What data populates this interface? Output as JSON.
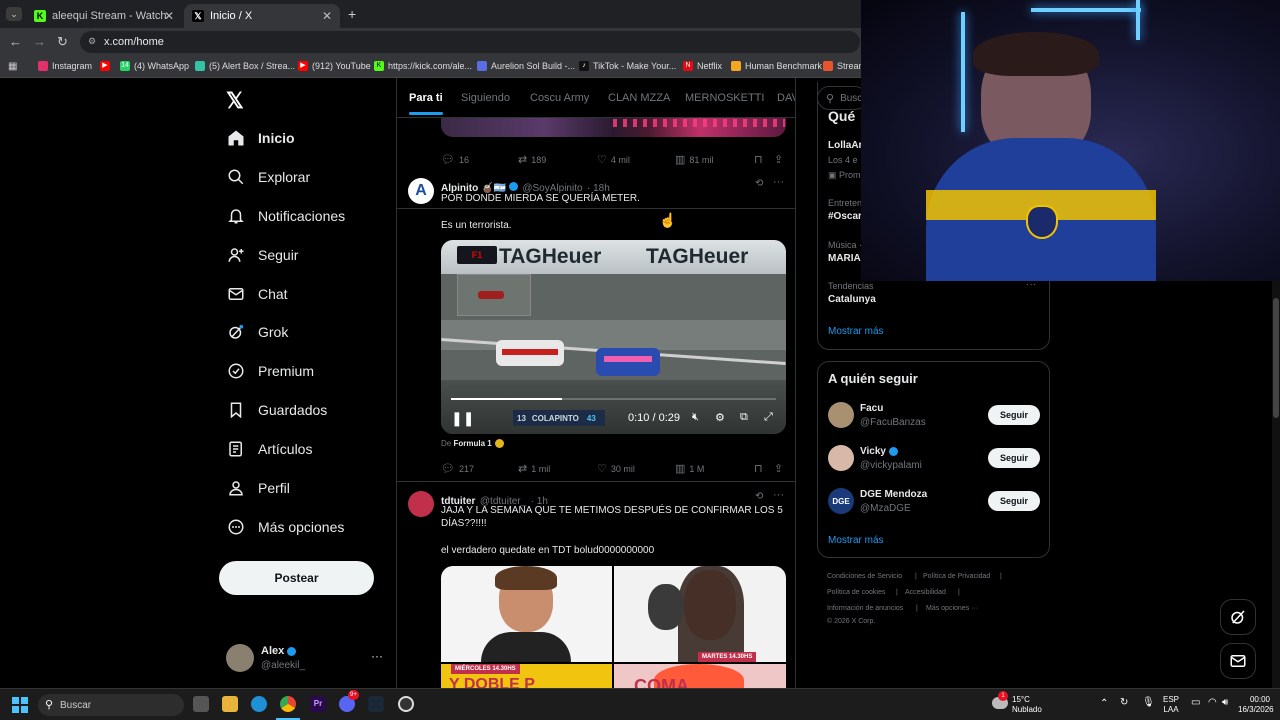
{
  "browser": {
    "tabs": [
      {
        "title": "aleequi Stream - Watch Live on",
        "favicon_color": "#53fc18",
        "favicon_text": "K"
      },
      {
        "title": "Inicio / X",
        "favicon_color": "#000000",
        "favicon_text": "𝕏"
      }
    ],
    "url": "x.com/home",
    "bookmarks": [
      {
        "label": "Instagram",
        "color": "#e1306c"
      },
      {
        "label": "(4) WhatsApp",
        "color": "#25d366",
        "badge": "14"
      },
      {
        "label": "(5) Alert Box / Strea...",
        "color": "#31c3a2"
      },
      {
        "label": "(912) YouTube",
        "color": "#ff0000"
      },
      {
        "label": "https://kick.com/ale...",
        "color": "#53fc18"
      },
      {
        "label": "Aurelion Sol Build -...",
        "color": "#5b6ee1"
      },
      {
        "label": "TikTok - Make Your...",
        "color": "#111111"
      },
      {
        "label": "Netflix",
        "color": "#e50914"
      },
      {
        "label": "Human Benchmark",
        "color": "#f5a623"
      },
      {
        "label": "Stream",
        "color": "#e8552d"
      }
    ]
  },
  "nav": {
    "logo": "𝕏",
    "items": [
      {
        "label": "Inicio",
        "icon": "home-icon"
      },
      {
        "label": "Explorar",
        "icon": "search-icon"
      },
      {
        "label": "Notificaciones",
        "icon": "bell-icon"
      },
      {
        "label": "Seguir",
        "icon": "add-user-icon"
      },
      {
        "label": "Chat",
        "icon": "mail-icon"
      },
      {
        "label": "Grok",
        "icon": "grok-icon"
      },
      {
        "label": "Premium",
        "icon": "verified-badge-icon"
      },
      {
        "label": "Guardados",
        "icon": "bookmark-icon"
      },
      {
        "label": "Artículos",
        "icon": "article-icon"
      },
      {
        "label": "Perfil",
        "icon": "user-icon"
      },
      {
        "label": "Más opciones",
        "icon": "more-circle-icon"
      }
    ],
    "post_label": "Postear",
    "account": {
      "name": "Alex",
      "handle": "@aleekil_"
    }
  },
  "timeline": {
    "tabs": [
      "Para ti",
      "Siguiendo",
      "Coscu Army",
      "CLAN MZZA",
      "MERNOSKETTI",
      "DAV"
    ],
    "top_tweet_actions": {
      "replies": "16",
      "reposts": "189",
      "likes": "4 mil",
      "views": "81 mil"
    },
    "tweets": [
      {
        "name": "Alpinito 🧉🇦🇷",
        "handle": "@SoyAlpinito",
        "time": "· 18h",
        "avatar_letter": "A",
        "lines": [
          "POR DONDE MIERDA SE QUERÍA METER.",
          "Es un terrorista."
        ],
        "video": {
          "time": "0:10 / 0:29",
          "banner": "TAGHeuer",
          "car_number": "13",
          "driver": "COLAPINTO",
          "gap": "43"
        },
        "source_prefix": "De",
        "source_name": "Formula 1",
        "actions": {
          "replies": "217",
          "reposts": "1 mil",
          "likes": "30 mil",
          "views": "1 M"
        }
      },
      {
        "name": "tdtuiter",
        "handle": "@tdtuiter_",
        "time": "· 1h",
        "lines": [
          "JAJA Y LA SEMANA QUE TE METIMOS DESPUÉS DE CONFIRMAR LOS 5",
          "DÍAS??!!!!",
          "el verdadero quedate en TDT bolud0000000000"
        ],
        "image_captions": [
          "MIÉRCOLES 14.30HS",
          "MARTES 14.30HS",
          "Y DOBLE P",
          "COMA"
        ]
      }
    ]
  },
  "right": {
    "search_placeholder": "Busc",
    "trends_heading_partial": "Qué",
    "trends": [
      {
        "category": "",
        "title": "LollaAr",
        "sub": "Los 4 e",
        "promo": "Prom"
      },
      {
        "category": "Entreten",
        "title": "#Oscar"
      },
      {
        "category": "Música ·",
        "title": "MARIA"
      },
      {
        "category": "Tendencias",
        "title": "Catalunya"
      }
    ],
    "show_more": "Mostrar más",
    "who_to_follow": {
      "title": "A quién seguir",
      "users": [
        {
          "name": "Facu",
          "handle": "@FacuBanzas",
          "verified": false
        },
        {
          "name": "Vicky",
          "handle": "@vickypalami",
          "verified": true
        },
        {
          "name": "DGE Mendoza",
          "handle": "@MzaDGE",
          "verified": false,
          "logo": "DGE"
        }
      ],
      "follow_label": "Seguir",
      "show_more": "Mostrar más"
    },
    "footer": {
      "links": [
        "Condiciones de Servicio",
        "Política de Privacidad",
        "Política de cookies",
        "Accesibilidad",
        "Información de anuncios",
        "Más opciones ···"
      ],
      "copyright": "© 2026 X Corp."
    }
  },
  "taskbar": {
    "search_placeholder": "Buscar",
    "weather_temp": "15°C",
    "weather_desc": "Nublado",
    "weather_badge": "1",
    "lang_top": "ESP",
    "lang_bottom": "LAA",
    "clock_time": "00:00",
    "clock_date": "16/3/2026",
    "discord_badge": "9+"
  },
  "colors": {
    "accent": "#1d9bf0",
    "bg": "#000000",
    "border": "#2f3336",
    "muted": "#71767b"
  }
}
